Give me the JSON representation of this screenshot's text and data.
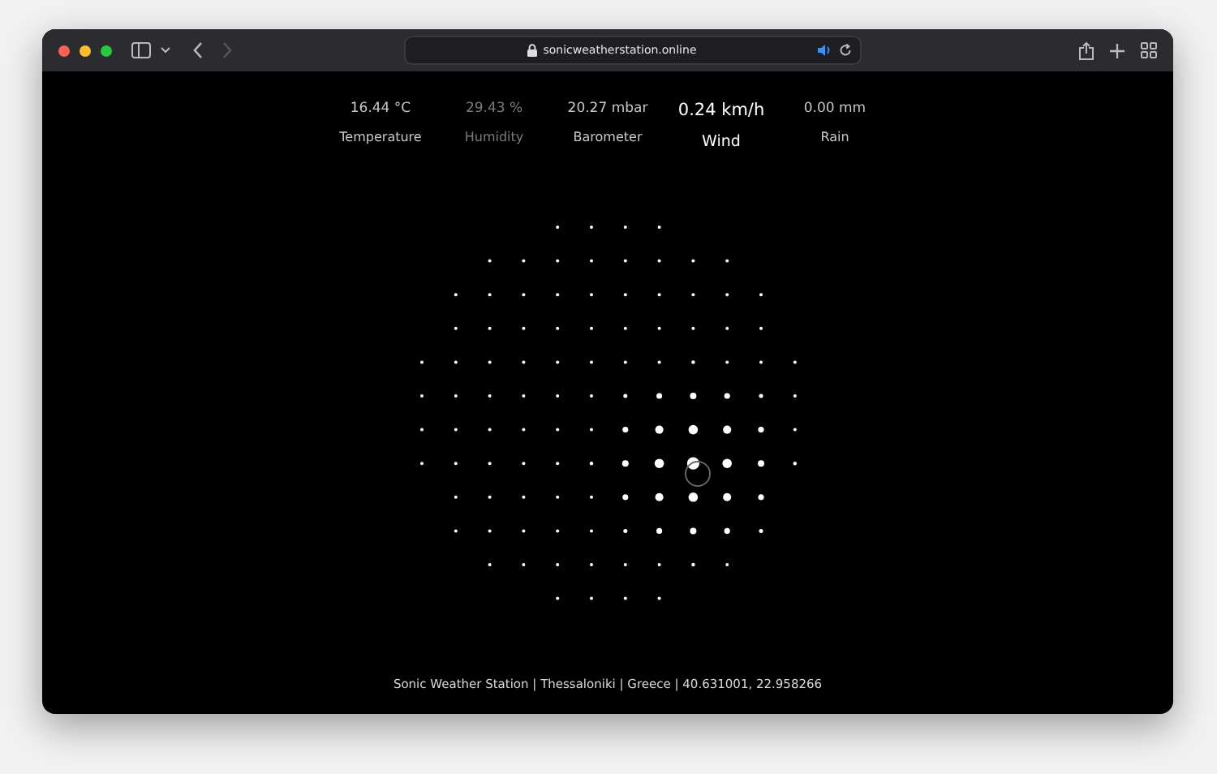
{
  "browser": {
    "url": "sonicweatherstation.online"
  },
  "metrics": [
    {
      "value": "16.44 °C",
      "label": "Temperature",
      "selected": false,
      "muted": false
    },
    {
      "value": "29.43 %",
      "label": "Humidity",
      "selected": false,
      "muted": true
    },
    {
      "value": "20.27 mbar",
      "label": "Barometer",
      "selected": false,
      "muted": false
    },
    {
      "value": "0.24 km/h",
      "label": "Wind",
      "selected": true,
      "muted": false
    },
    {
      "value": "0.00 mm",
      "label": "Rain",
      "selected": false,
      "muted": false
    }
  ],
  "footer": "Sonic Weather Station | Thessaloniki | Greece | 40.631001, 22.958266"
}
